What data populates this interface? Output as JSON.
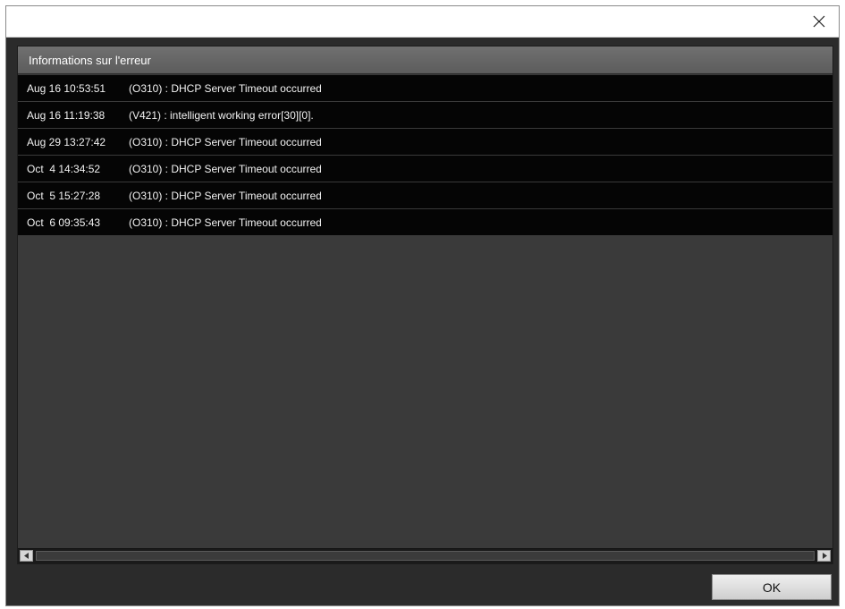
{
  "window": {
    "title": "                            "
  },
  "panel": {
    "header": "Informations sur l'erreur",
    "rows": [
      {
        "date": "Aug 16 10:53:51",
        "message": "(O310) :  DHCP Server Timeout occurred"
      },
      {
        "date": "Aug 16 11:19:38",
        "message": "(V421) :  intelligent working error[30][0]."
      },
      {
        "date": "Aug 29 13:27:42",
        "message": "(O310) :  DHCP Server Timeout occurred"
      },
      {
        "date": "Oct  4 14:34:52",
        "message": "(O310) :  DHCP Server Timeout occurred"
      },
      {
        "date": "Oct  5 15:27:28",
        "message": "(O310) :  DHCP Server Timeout occurred"
      },
      {
        "date": "Oct  6 09:35:43",
        "message": "(O310) :  DHCP Server Timeout occurred"
      }
    ]
  },
  "buttons": {
    "ok": "OK"
  },
  "icons": {
    "close": "close-icon",
    "scroll_left": "arrow-left-icon",
    "scroll_right": "arrow-right-icon"
  },
  "colors": {
    "row_background": "#050505",
    "panel_background": "#3a3a3a",
    "header_background": "#636363"
  }
}
